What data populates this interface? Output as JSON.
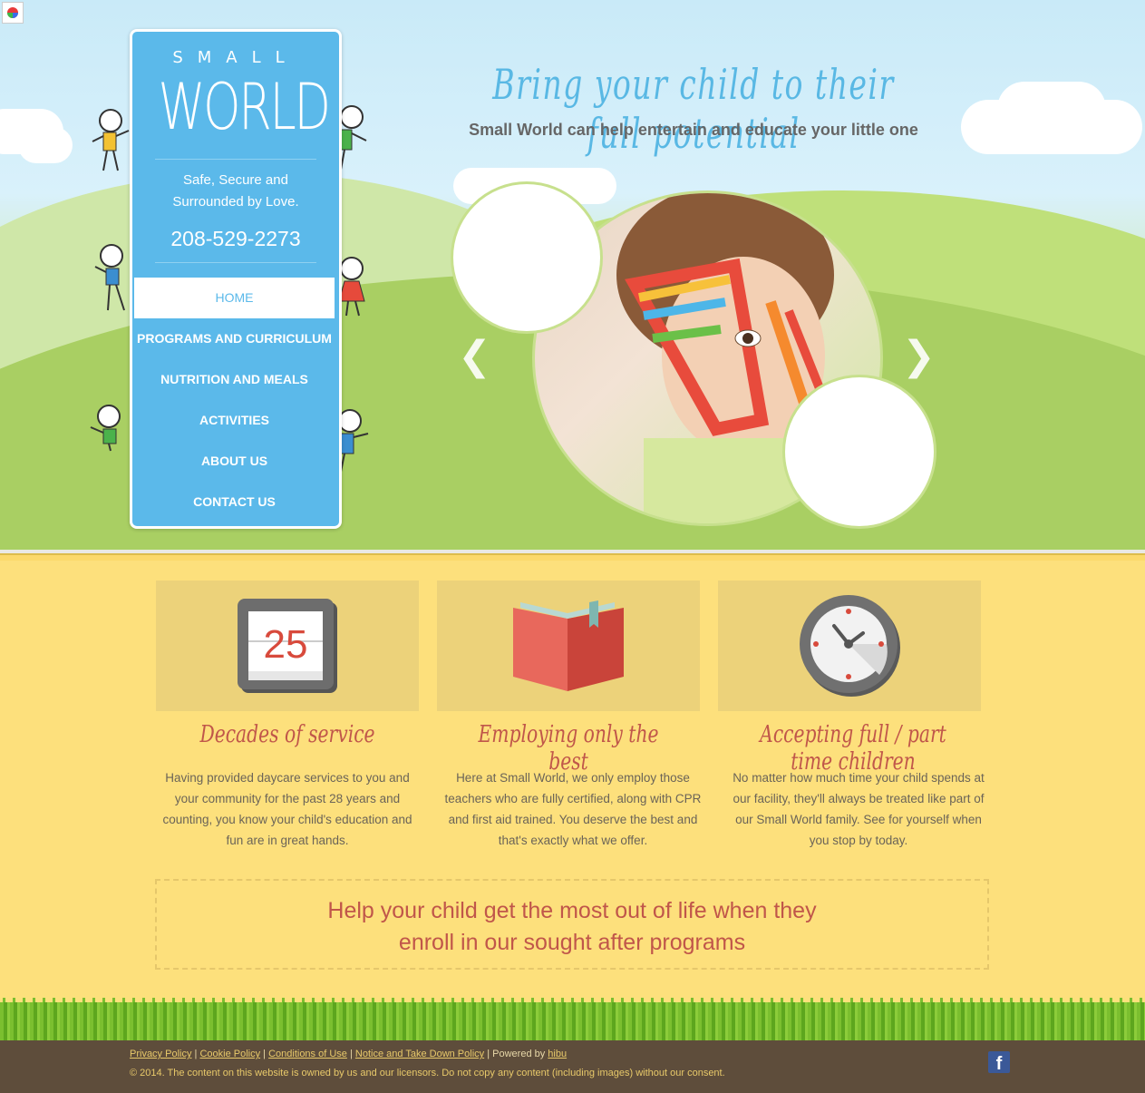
{
  "header": {
    "headline": "Bring your child to their full potential",
    "subhead": "Small World can help entertain and educate your little one"
  },
  "sidebar": {
    "logo_small": "SMALL",
    "logo_big": "WORLD",
    "tagline_line1": "Safe, Secure and",
    "tagline_line2": "Surrounded by Love.",
    "phone": "208-529-2273",
    "nav": [
      {
        "label": "HOME",
        "active": true
      },
      {
        "label": "PROGRAMS AND CURRICULUM"
      },
      {
        "label": "NUTRITION AND MEALS"
      },
      {
        "label": "ACTIVITIES"
      },
      {
        "label": "ABOUT US"
      },
      {
        "label": "CONTACT US"
      }
    ]
  },
  "slider": {
    "prev_icon": "chevron-left-icon",
    "next_icon": "chevron-right-icon"
  },
  "features": [
    {
      "icon": "calendar-icon",
      "icon_text": "25",
      "title": "Decades of service",
      "text": "Having provided daycare services to you and your community for the past 28 years and counting, you know your child's education and fun are in great hands."
    },
    {
      "icon": "book-icon",
      "title": "Employing only the best",
      "text": "Here at Small World, we only employ those teachers who are fully certified, along with CPR and first aid trained. You deserve the best and that's exactly what we offer."
    },
    {
      "icon": "clock-icon",
      "title": "Accepting full / part time children",
      "text": "No matter how much time your child spends at our facility, they'll always be treated like part of our Small World family. See for yourself when you stop by today."
    }
  ],
  "cta": {
    "line1": "Help your child get the most out of life when they",
    "line2": "enroll in our sought after programs"
  },
  "footer": {
    "links": [
      "Privacy Policy",
      "Cookie Policy",
      "Conditions of Use",
      "Notice and Take Down Policy"
    ],
    "powered_by_label": "Powered by",
    "powered_by_link": "hibu",
    "copyright": "© 2014. The content on this website is owned by us and our licensors. Do not copy any content (including images) without our consent.",
    "social_icon": "facebook-icon"
  },
  "colors": {
    "sidebar_blue": "#5bb9ea",
    "title_red": "#c0564a",
    "page_yellow": "#fde07c",
    "footer_brown": "#5e4d3b"
  }
}
